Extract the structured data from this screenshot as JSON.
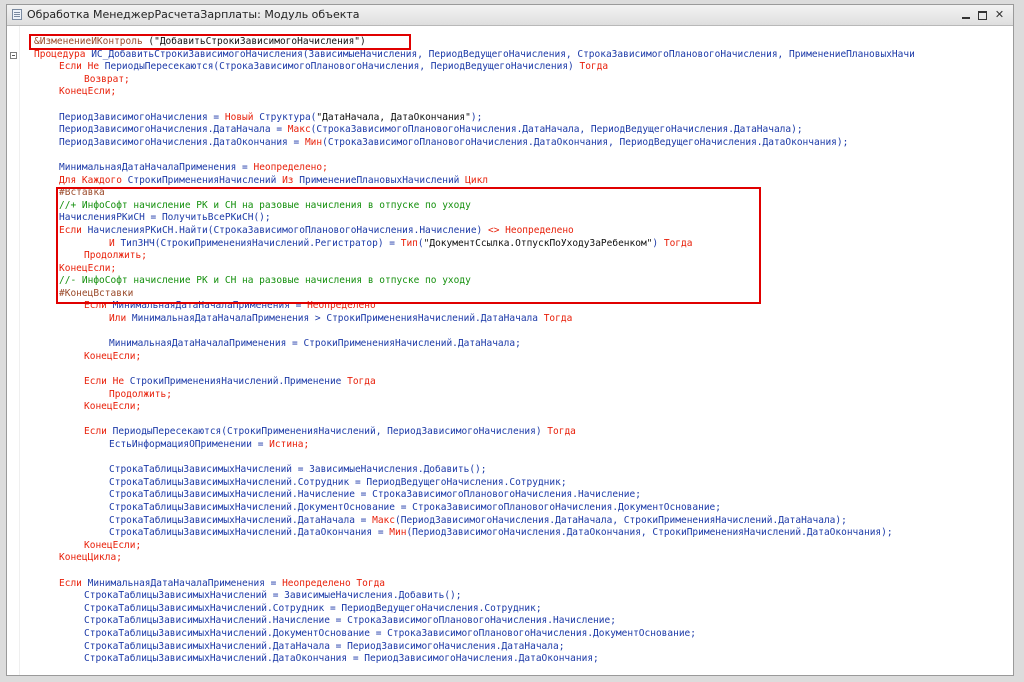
{
  "window": {
    "title": "Обработка МенеджерРасчетаЗарплаты: Модуль объекта",
    "minimize_label": "",
    "maximize_label": "",
    "close_label": "✕"
  },
  "highlight_color": "#e00000",
  "code_lines": [
    {
      "i": 1,
      "fold": false,
      "parts": [
        [
          "pre",
          "&ИзменениеИКонтроль "
        ],
        [
          "str",
          "(\"ДобавитьСтрокиЗависимогоНачисления\")"
        ]
      ]
    },
    {
      "i": 0,
      "fold": true,
      "parts": [
        [
          "kw",
          "Процедура"
        ],
        [
          "id",
          " ИС_ДобавитьСтрокиЗависимогоНачисления(ЗависимыеНачисления, ПериодВедущегоНачисления, СтрокаЗависимогоПлановогоНачисления, ПрименениеПлановыхНачи"
        ]
      ]
    },
    {
      "i": 2,
      "fold": false,
      "parts": [
        [
          "kw",
          "Если Не "
        ],
        [
          "id",
          "ПериодыПересекаются(СтрокаЗависимогоПлановогоНачисления, ПериодВедущегоНачисления) "
        ],
        [
          "kw",
          "Тогда"
        ]
      ]
    },
    {
      "i": 3,
      "fold": false,
      "parts": [
        [
          "kw",
          "Возврат;"
        ]
      ]
    },
    {
      "i": 2,
      "fold": false,
      "parts": [
        [
          "kw",
          "КонецЕсли;"
        ]
      ]
    },
    {
      "i": 2,
      "fold": false,
      "parts": []
    },
    {
      "i": 2,
      "fold": false,
      "parts": [
        [
          "id",
          "ПериодЗависимогоНачисления = "
        ],
        [
          "kw",
          "Новый "
        ],
        [
          "id",
          "Структура("
        ],
        [
          "str",
          "\"ДатаНачала, ДатаОкончания\""
        ],
        [
          "id",
          ");"
        ]
      ]
    },
    {
      "i": 2,
      "fold": false,
      "parts": [
        [
          "id",
          "ПериодЗависимогоНачисления.ДатаНачала = "
        ],
        [
          "kw",
          "Макс"
        ],
        [
          "id",
          "(СтрокаЗависимогоПлановогоНачисления.ДатаНачала, ПериодВедущегоНачисления.ДатаНачала);"
        ]
      ]
    },
    {
      "i": 2,
      "fold": false,
      "parts": [
        [
          "id",
          "ПериодЗависимогоНачисления.ДатаОкончания = "
        ],
        [
          "kw",
          "Мин"
        ],
        [
          "id",
          "(СтрокаЗависимогоПлановогоНачисления.ДатаОкончания, ПериодВедущегоНачисления.ДатаОкончания);"
        ]
      ]
    },
    {
      "i": 2,
      "fold": false,
      "parts": []
    },
    {
      "i": 2,
      "fold": false,
      "parts": [
        [
          "id",
          "МинимальнаяДатаНачалаПрименения = "
        ],
        [
          "kw",
          "Неопределено;"
        ]
      ]
    },
    {
      "i": 2,
      "fold": false,
      "parts": [
        [
          "kw",
          "Для Каждого "
        ],
        [
          "id",
          "СтрокиПримененияНачислений "
        ],
        [
          "kw",
          "Из "
        ],
        [
          "id",
          "ПрименениеПлановыхНачислений "
        ],
        [
          "kw",
          "Цикл"
        ]
      ]
    },
    {
      "i": 2,
      "fold": false,
      "parts": [
        [
          "pre",
          "#Вставка"
        ]
      ]
    },
    {
      "i": 2,
      "fold": false,
      "parts": [
        [
          "cm",
          "//+ ИнфоСофт начисление РК и СН на разовые начисления в отпуске по уходу"
        ]
      ]
    },
    {
      "i": 2,
      "fold": false,
      "parts": [
        [
          "id",
          "НачисленияРКиСН = ПолучитьВсеРКиСН();"
        ]
      ]
    },
    {
      "i": 2,
      "fold": false,
      "parts": [
        [
          "kw",
          "Если "
        ],
        [
          "id",
          "НачисленияРКиСН.Найти(СтрокаЗависимогоПлановогоНачисления.Начисление) "
        ],
        [
          "kw",
          "<> Неопределено"
        ]
      ]
    },
    {
      "i": 4,
      "fold": false,
      "parts": [
        [
          "kw",
          "И "
        ],
        [
          "id",
          "ТипЗНЧ(СтрокиПримененияНачислений.Регистратор) = "
        ],
        [
          "kw",
          "Тип"
        ],
        [
          "id",
          "("
        ],
        [
          "str",
          "\"ДокументСсылка.ОтпускПоУходуЗаРебенком\""
        ],
        [
          "id",
          ") "
        ],
        [
          "kw",
          "Тогда"
        ]
      ]
    },
    {
      "i": 3,
      "fold": false,
      "parts": [
        [
          "kw",
          "Продолжить;"
        ]
      ]
    },
    {
      "i": 2,
      "fold": false,
      "parts": [
        [
          "kw",
          "КонецЕсли;"
        ]
      ]
    },
    {
      "i": 2,
      "fold": false,
      "parts": [
        [
          "cm",
          "//- ИнфоСофт начисление РК и СН на разовые начисления в отпуске по уходу"
        ]
      ]
    },
    {
      "i": 2,
      "fold": false,
      "parts": [
        [
          "pre",
          "#КонецВставки"
        ]
      ]
    },
    {
      "i": 3,
      "fold": false,
      "parts": [
        [
          "kw",
          "Если "
        ],
        [
          "id",
          "МинимальнаяДатаНачалаПрименения = "
        ],
        [
          "kw",
          "Неопределено"
        ]
      ]
    },
    {
      "i": 4,
      "fold": false,
      "parts": [
        [
          "kw",
          "Или "
        ],
        [
          "id",
          "МинимальнаяДатаНачалаПрименения > СтрокиПримененияНачислений.ДатаНачала "
        ],
        [
          "kw",
          "Тогда"
        ]
      ]
    },
    {
      "i": 4,
      "fold": false,
      "parts": []
    },
    {
      "i": 4,
      "fold": false,
      "parts": [
        [
          "id",
          "МинимальнаяДатаНачалаПрименения = СтрокиПримененияНачислений.ДатаНачала;"
        ]
      ]
    },
    {
      "i": 3,
      "fold": false,
      "parts": [
        [
          "kw",
          "КонецЕсли;"
        ]
      ]
    },
    {
      "i": 3,
      "fold": false,
      "parts": []
    },
    {
      "i": 3,
      "fold": false,
      "parts": [
        [
          "kw",
          "Если Не "
        ],
        [
          "id",
          "СтрокиПримененияНачислений.Применение "
        ],
        [
          "kw",
          "Тогда"
        ]
      ]
    },
    {
      "i": 4,
      "fold": false,
      "parts": [
        [
          "kw",
          "Продолжить;"
        ]
      ]
    },
    {
      "i": 3,
      "fold": false,
      "parts": [
        [
          "kw",
          "КонецЕсли;"
        ]
      ]
    },
    {
      "i": 3,
      "fold": false,
      "parts": []
    },
    {
      "i": 3,
      "fold": false,
      "parts": [
        [
          "kw",
          "Если "
        ],
        [
          "id",
          "ПериодыПересекаются(СтрокиПримененияНачислений, ПериодЗависимогоНачисления) "
        ],
        [
          "kw",
          "Тогда"
        ]
      ]
    },
    {
      "i": 4,
      "fold": false,
      "parts": [
        [
          "id",
          "ЕстьИнформацияОПрименении = "
        ],
        [
          "kw",
          "Истина;"
        ]
      ]
    },
    {
      "i": 4,
      "fold": false,
      "parts": []
    },
    {
      "i": 4,
      "fold": false,
      "parts": [
        [
          "id",
          "СтрокаТаблицыЗависимыхНачислений = ЗависимыеНачисления.Добавить();"
        ]
      ]
    },
    {
      "i": 4,
      "fold": false,
      "parts": [
        [
          "id",
          "СтрокаТаблицыЗависимыхНачислений.Сотрудник = ПериодВедущегоНачисления.Сотрудник;"
        ]
      ]
    },
    {
      "i": 4,
      "fold": false,
      "parts": [
        [
          "id",
          "СтрокаТаблицыЗависимыхНачислений.Начисление = СтрокаЗависимогоПлановогоНачисления.Начисление;"
        ]
      ]
    },
    {
      "i": 4,
      "fold": false,
      "parts": [
        [
          "id",
          "СтрокаТаблицыЗависимыхНачислений.ДокументОснование = СтрокаЗависимогоПлановогоНачисления.ДокументОснование;"
        ]
      ]
    },
    {
      "i": 4,
      "fold": false,
      "parts": [
        [
          "id",
          "СтрокаТаблицыЗависимыхНачислений.ДатаНачала = "
        ],
        [
          "kw",
          "Макс"
        ],
        [
          "id",
          "(ПериодЗависимогоНачисления.ДатаНачала, СтрокиПримененияНачислений.ДатаНачала);"
        ]
      ]
    },
    {
      "i": 4,
      "fold": false,
      "parts": [
        [
          "id",
          "СтрокаТаблицыЗависимыхНачислений.ДатаОкончания = "
        ],
        [
          "kw",
          "Мин"
        ],
        [
          "id",
          "(ПериодЗависимогоНачисления.ДатаОкончания, СтрокиПримененияНачислений.ДатаОкончания);"
        ]
      ]
    },
    {
      "i": 3,
      "fold": false,
      "parts": [
        [
          "kw",
          "КонецЕсли;"
        ]
      ]
    },
    {
      "i": 2,
      "fold": false,
      "parts": [
        [
          "kw",
          "КонецЦикла;"
        ]
      ]
    },
    {
      "i": 2,
      "fold": false,
      "parts": []
    },
    {
      "i": 2,
      "fold": false,
      "parts": [
        [
          "kw",
          "Если "
        ],
        [
          "id",
          "МинимальнаяДатаНачалаПрименения = "
        ],
        [
          "kw",
          "Неопределено Тогда"
        ]
      ]
    },
    {
      "i": 3,
      "fold": false,
      "parts": [
        [
          "id",
          "СтрокаТаблицыЗависимыхНачислений = ЗависимыеНачисления.Добавить();"
        ]
      ]
    },
    {
      "i": 3,
      "fold": false,
      "parts": [
        [
          "id",
          "СтрокаТаблицыЗависимыхНачислений.Сотрудник = ПериодВедущегоНачисления.Сотрудник;"
        ]
      ]
    },
    {
      "i": 3,
      "fold": false,
      "parts": [
        [
          "id",
          "СтрокаТаблицыЗависимыхНачислений.Начисление = СтрокаЗависимогоПлановогоНачисления.Начисление;"
        ]
      ]
    },
    {
      "i": 3,
      "fold": false,
      "parts": [
        [
          "id",
          "СтрокаТаблицыЗависимыхНачислений.ДокументОснование = СтрокаЗависимогоПлановогоНачисления.ДокументОснование;"
        ]
      ]
    },
    {
      "i": 3,
      "fold": false,
      "parts": [
        [
          "id",
          "СтрокаТаблицыЗависимыхНачислений.ДатаНачала = ПериодЗависимогоНачисления.ДатаНачала;"
        ]
      ]
    },
    {
      "i": 3,
      "fold": false,
      "parts": [
        [
          "id",
          "СтрокаТаблицыЗависимыхНачислений.ДатаОкончания = ПериодЗависимогоНачисления.ДатаОкончания;"
        ]
      ]
    }
  ]
}
